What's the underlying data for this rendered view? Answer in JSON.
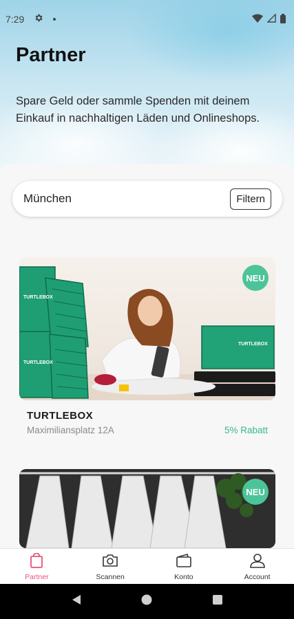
{
  "status_bar": {
    "time": "7:29"
  },
  "header": {
    "title": "Partner",
    "description": "Spare Geld oder sammle Spenden mit deinem Einkauf in nachhaltigen Läden und Onlineshops."
  },
  "search": {
    "location": "München",
    "filter_label": "Filtern"
  },
  "partners": [
    {
      "name": "TURTLEBOX",
      "address": "Maximiliansplatz 12A",
      "discount": "5% Rabatt",
      "badge": "NEU"
    },
    {
      "badge": "NEU"
    }
  ],
  "bottom_nav": {
    "items": [
      {
        "label": "Partner",
        "icon": "shopping-bag-icon",
        "active": true
      },
      {
        "label": "Scannen",
        "icon": "camera-icon"
      },
      {
        "label": "Konto",
        "icon": "wallet-icon"
      },
      {
        "label": "Account",
        "icon": "person-icon"
      }
    ]
  },
  "colors": {
    "accent": "#4cc49a",
    "active_nav": "#e8527a",
    "discount": "#3ab88a"
  }
}
